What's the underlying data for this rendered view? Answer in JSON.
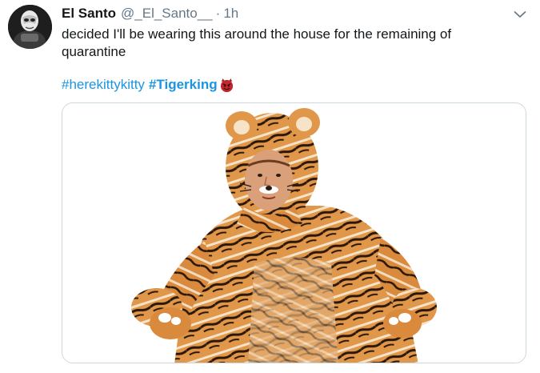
{
  "tweet": {
    "display_name": "El Santo",
    "handle": "@_El_Santo__",
    "separator": "·",
    "time": "1h",
    "text": "decided I'll be wearing this around the house for the remaining of quarantine",
    "hashtags": [
      "#herekittykitty",
      "#Tigerking"
    ],
    "emoji": "devil-face-emoji",
    "icons": {
      "caret": "chevron-down-icon",
      "avatar": "profile-avatar"
    },
    "media": {
      "type": "photo",
      "subject": "person-in-tiger-costume"
    },
    "colors": {
      "hashtag": "#1b95e0",
      "secondary_text": "#657786",
      "border": "#ccd6dd"
    }
  }
}
